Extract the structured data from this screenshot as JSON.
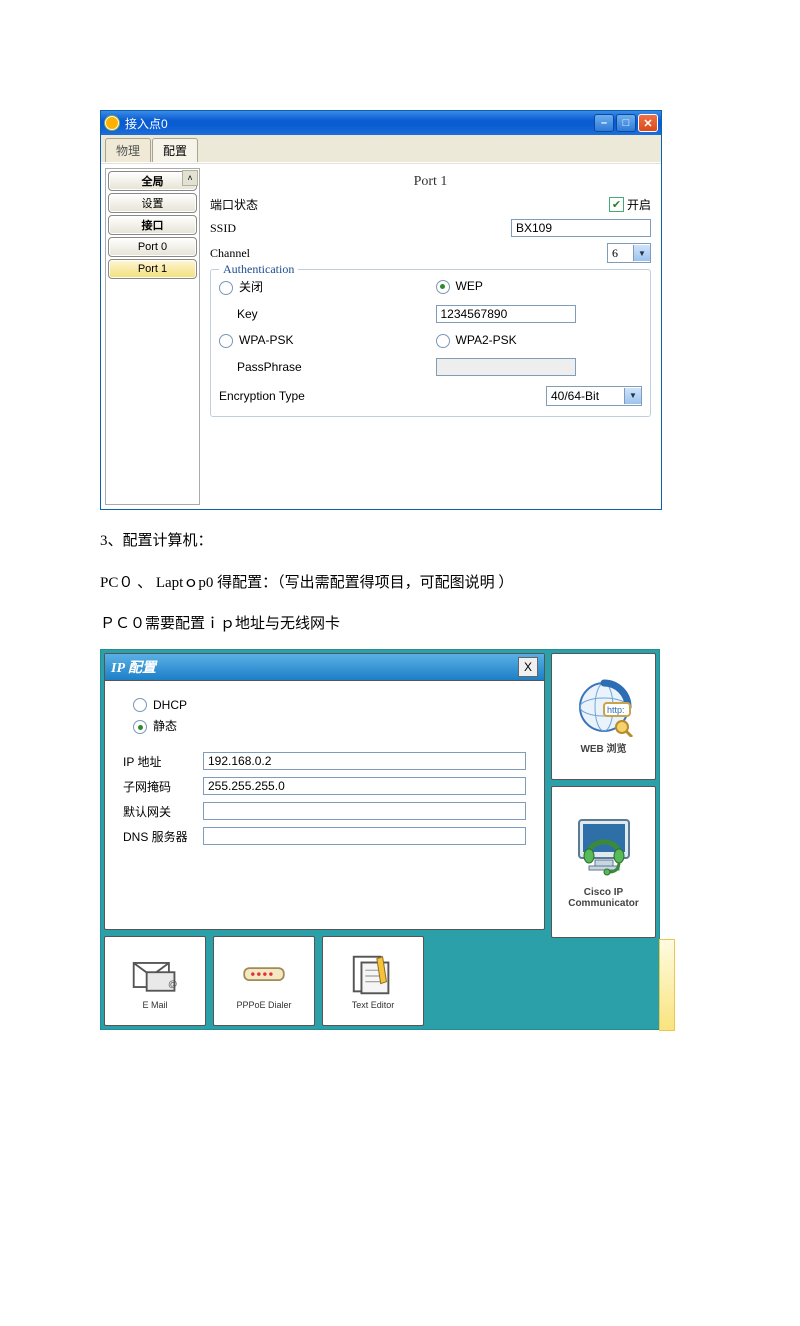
{
  "win1": {
    "title": "接入点0",
    "tabs": {
      "t1": "物理",
      "t2": "配置"
    },
    "sidebar": {
      "global": "全局",
      "settings": "设置",
      "iface": "接口",
      "port0": "Port 0",
      "port1": "Port 1"
    },
    "port": {
      "title": "Port 1",
      "state_lbl": "端口状态",
      "state_val": "开启",
      "ssid_lbl": "SSID",
      "ssid_val": "BX109",
      "chan_lbl": "Channel",
      "chan_val": "6"
    },
    "auth": {
      "legend": "Authentication",
      "off": "关闭",
      "wep": "WEP",
      "key_lbl": "Key",
      "key_val": "1234567890",
      "wpa": "WPA-PSK",
      "wpa2": "WPA2-PSK",
      "pass_lbl": "PassPhrase",
      "enc_lbl": "Encryption Type",
      "enc_val": "40/64-Bit"
    }
  },
  "text": {
    "p1": "3、配置计算机：",
    "p2": "PC０ 、 Laptｏp0 得配置：（写出需配置得项目，可配图说明 ）",
    "p3": "ＰＣ０需要配置ｉｐ地址与无线网卡"
  },
  "ip": {
    "title": "IP 配置",
    "dhcp": "DHCP",
    "static": "静态",
    "ip_lbl": "IP 地址",
    "ip_val": "192.168.0.2",
    "mask_lbl": "子网掩码",
    "mask_val": "255.255.255.0",
    "gw_lbl": "默认网关",
    "gw_val": "",
    "dns_lbl": "DNS 服务器",
    "dns_val": ""
  },
  "apps": {
    "right1": "WEB 浏览",
    "right2": "Cisco IP Communicator",
    "a1": "E Mail",
    "a2": "PPPoE Dialer",
    "a3": "Text Editor"
  }
}
